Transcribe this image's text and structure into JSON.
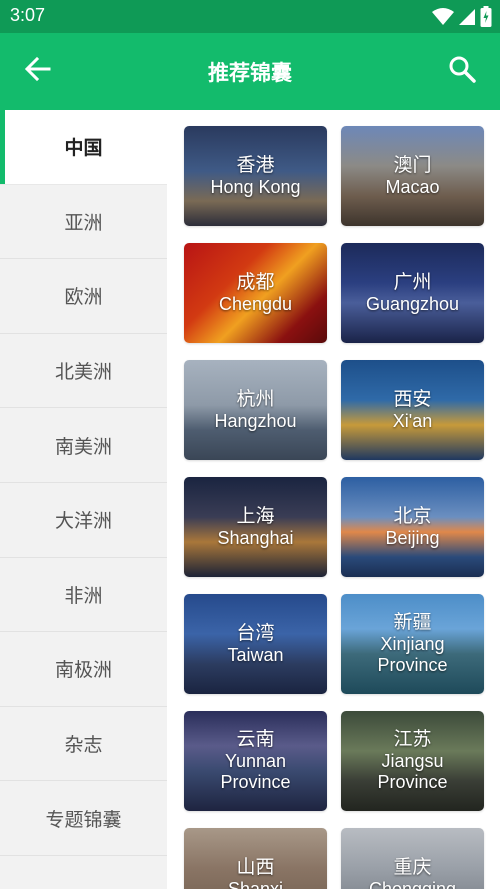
{
  "status_bar": {
    "time": "3:07"
  },
  "app_bar": {
    "title": "推荐锦囊"
  },
  "sidebar": {
    "items": [
      {
        "label": "中国",
        "active": true
      },
      {
        "label": "亚洲"
      },
      {
        "label": "欧洲"
      },
      {
        "label": "北美洲"
      },
      {
        "label": "南美洲"
      },
      {
        "label": "大洋洲"
      },
      {
        "label": "非洲"
      },
      {
        "label": "南极洲"
      },
      {
        "label": "杂志"
      },
      {
        "label": "专题锦囊"
      }
    ]
  },
  "accent_color": "#13bb6c",
  "cards": [
    {
      "cn": "香港",
      "en": "Hong Kong",
      "en2": ""
    },
    {
      "cn": "澳门",
      "en": "Macao",
      "en2": ""
    },
    {
      "cn": "成都",
      "en": "Chengdu",
      "en2": ""
    },
    {
      "cn": "广州",
      "en": "Guangzhou",
      "en2": ""
    },
    {
      "cn": "杭州",
      "en": "Hangzhou",
      "en2": ""
    },
    {
      "cn": "西安",
      "en": "Xi'an",
      "en2": ""
    },
    {
      "cn": "上海",
      "en": "Shanghai",
      "en2": ""
    },
    {
      "cn": "北京",
      "en": "Beijing",
      "en2": ""
    },
    {
      "cn": "台湾",
      "en": "Taiwan",
      "en2": ""
    },
    {
      "cn": "新疆",
      "en": "Xinjiang",
      "en2": "Province"
    },
    {
      "cn": "云南",
      "en": "Yunnan",
      "en2": "Province"
    },
    {
      "cn": "江苏",
      "en": "Jiangsu",
      "en2": "Province"
    },
    {
      "cn": "山西",
      "en": "Shanxi",
      "en2": ""
    },
    {
      "cn": "重庆",
      "en": "Chongqing",
      "en2": ""
    }
  ]
}
